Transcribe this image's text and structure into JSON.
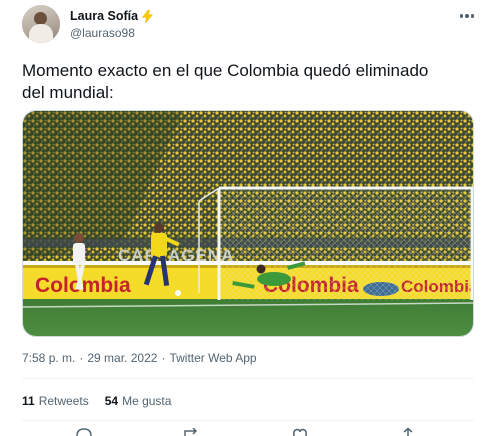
{
  "user": {
    "display_name": "Laura Sofía",
    "handle": "@lauraso98"
  },
  "tweet": {
    "text": "Momento exacto en el que Colombia quedó eliminado\ndel mundial:"
  },
  "media": {
    "sponsor_text": "Colombia",
    "stadium_text": "CARTAGENA"
  },
  "meta": {
    "time": "7:58 p. m.",
    "separator1": "·",
    "date": "29 mar. 2022",
    "separator2": "·",
    "source": "Twitter Web App"
  },
  "stats": {
    "retweets_count": "11",
    "retweets_label": "Retweets",
    "likes_count": "54",
    "likes_label": "Me gusta"
  },
  "colors": {
    "text": "#0f1419",
    "secondary": "#536471",
    "verified_bolt": "#ffd400"
  }
}
